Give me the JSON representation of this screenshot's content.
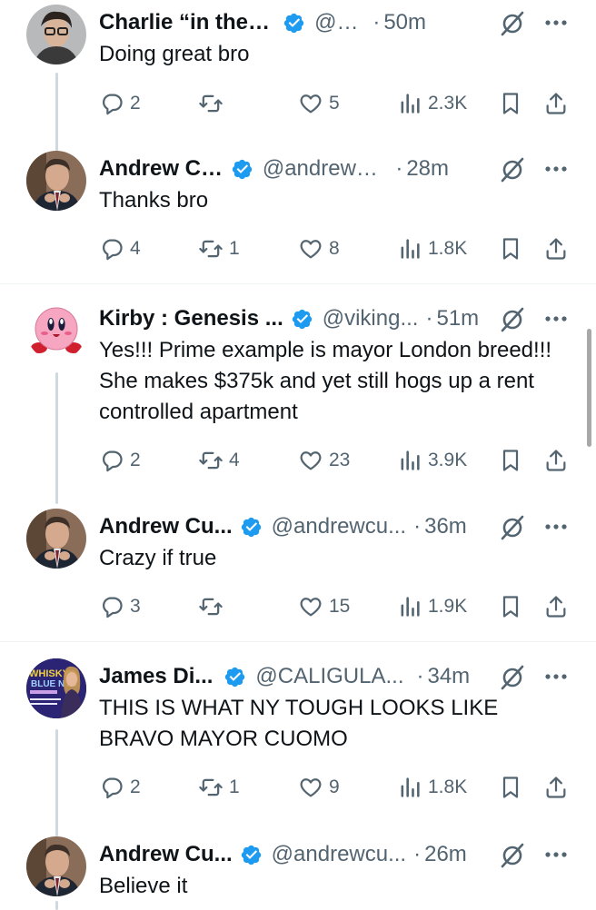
{
  "tweets": [
    {
      "name": "Charlie “in the are...",
      "handle": "@ra...",
      "time": "50m",
      "text": "Doing great bro",
      "replies": "2",
      "reposts": "",
      "likes": "5",
      "views": "2.3K",
      "avatar": "charlie-avatar"
    },
    {
      "name": "Andrew Cu...",
      "handle": "@andrewcu...",
      "time": "28m",
      "text": "Thanks bro",
      "replies": "4",
      "reposts": "1",
      "likes": "8",
      "views": "1.8K",
      "avatar": "andrew-avatar"
    },
    {
      "name": "Kirby : Genesis ...",
      "handle": "@viking...",
      "time": "51m",
      "text": "Yes!!! Prime example is mayor London breed!!! She makes $375k and yet still hogs up a rent controlled apartment",
      "replies": "2",
      "reposts": "4",
      "likes": "23",
      "views": "3.9K",
      "avatar": "kirby-avatar"
    },
    {
      "name": "Andrew Cu...",
      "handle": "@andrewcu...",
      "time": "36m",
      "text": "Crazy if true",
      "replies": "3",
      "reposts": "",
      "likes": "15",
      "views": "1.9K",
      "avatar": "andrew-avatar"
    },
    {
      "name": "James Di...",
      "handle": "@CALIGULA...",
      "time": "34m",
      "text": "THIS IS WHAT NY TOUGH LOOKS LIKE BRAVO MAYOR CUOMO",
      "replies": "2",
      "reposts": "1",
      "likes": "9",
      "views": "1.8K",
      "avatar": "whisky-avatar",
      "avatar_text": [
        "WHISKY",
        "BLUE NYC"
      ]
    },
    {
      "name": "Andrew Cu...",
      "handle": "@andrewcu...",
      "time": "26m",
      "text": "Believe it",
      "avatar": "andrew-avatar"
    }
  ],
  "separator": "·",
  "colors": {
    "verified": "#1d9bf0",
    "muted": "#536471",
    "text": "#0f1419",
    "thread_line": "#cfd9de"
  }
}
